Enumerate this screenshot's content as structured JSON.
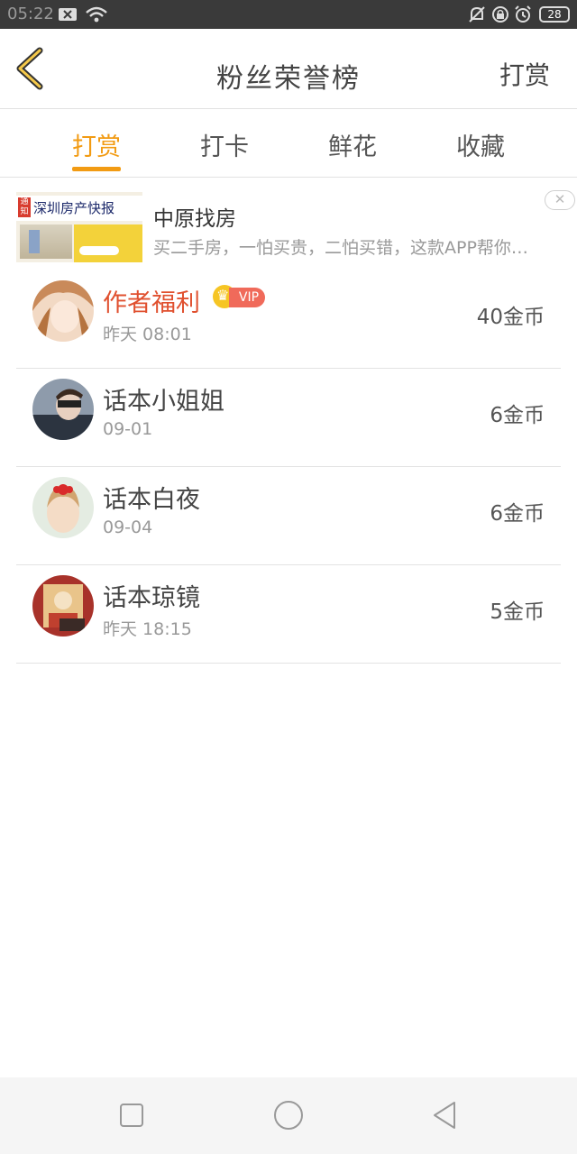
{
  "status_bar": {
    "time": "05:22",
    "battery": "28",
    "icons": [
      "close-notification-icon",
      "wifi-icon",
      "bell-off-icon",
      "lock-rotation-icon",
      "alarm-icon",
      "battery-icon"
    ]
  },
  "header": {
    "title": "粉丝荣誉榜",
    "action_label": "打赏",
    "back_icon": "chevron-left-icon",
    "accent": "#f29b13"
  },
  "tabs": [
    {
      "label": "打赏",
      "active": true
    },
    {
      "label": "打卡",
      "active": false
    },
    {
      "label": "鲜花",
      "active": false
    },
    {
      "label": "收藏",
      "active": false
    }
  ],
  "ad": {
    "thumb_tag": "通知",
    "thumb_headline": "深圳房产快报",
    "title": "中原找房",
    "description": "买二手房，一怕买贵，二怕买错，这款APP帮你解决",
    "close_icon": "close-icon"
  },
  "ranking": [
    {
      "name": "作者福利",
      "time": "昨天 08:01",
      "amount": "40金币",
      "vip": true,
      "vip_label": "VIP",
      "name_color": "#e0502f"
    },
    {
      "name": "话本小姐姐",
      "time": "09-01",
      "amount": "6金币",
      "vip": false
    },
    {
      "name": "话本白夜",
      "time": "09-04",
      "amount": "6金币",
      "vip": false
    },
    {
      "name": "话本琼镜",
      "time": "昨天 18:15",
      "amount": "5金币",
      "vip": false
    }
  ],
  "nav_bar": {
    "icons": [
      "square-recents-icon",
      "circle-home-icon",
      "triangle-back-icon"
    ]
  }
}
